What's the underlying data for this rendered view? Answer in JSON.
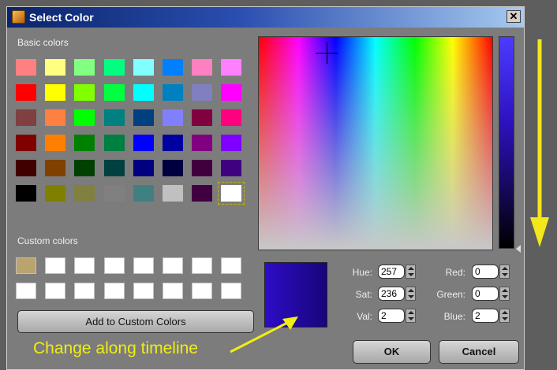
{
  "window": {
    "title": "Select Color",
    "close_label": "✕"
  },
  "basic_colors_label": "Basic colors",
  "custom_colors_label": "Custom colors",
  "basic_colors": [
    "#ff8080",
    "#ffff80",
    "#80ff80",
    "#00ff80",
    "#80ffff",
    "#0080ff",
    "#ff80c0",
    "#ff80ff",
    "#ff0000",
    "#ffff00",
    "#80ff00",
    "#00ff40",
    "#00ffff",
    "#0080c0",
    "#8080c0",
    "#ff00ff",
    "#804040",
    "#ff8040",
    "#00ff00",
    "#008080",
    "#004080",
    "#8080ff",
    "#800040",
    "#ff0080",
    "#800000",
    "#ff8000",
    "#008000",
    "#008040",
    "#0000ff",
    "#0000a0",
    "#800080",
    "#8000ff",
    "#400000",
    "#804000",
    "#004000",
    "#004040",
    "#000080",
    "#000040",
    "#400040",
    "#400080",
    "#000000",
    "#808000",
    "#808040",
    "#808080",
    "#408080",
    "#c0c0c0",
    "#400040",
    "#ffffff"
  ],
  "custom_colors": [
    "#b9a46e",
    "#ffffff",
    "#ffffff",
    "#ffffff",
    "#ffffff",
    "#ffffff",
    "#ffffff",
    "#ffffff",
    "#ffffff",
    "#ffffff",
    "#ffffff",
    "#ffffff",
    "#ffffff",
    "#ffffff",
    "#ffffff",
    "#ffffff"
  ],
  "buttons": {
    "add_custom": "Add to Custom Colors",
    "ok": "OK",
    "cancel": "Cancel"
  },
  "fields": {
    "hue": {
      "label": "Hue:",
      "value": "257"
    },
    "sat": {
      "label": "Sat:",
      "value": "236"
    },
    "val": {
      "label": "Val:",
      "value": "2"
    },
    "red": {
      "label": "Red:",
      "value": "0"
    },
    "green": {
      "label": "Green:",
      "value": "0"
    },
    "blue": {
      "label": "Blue:",
      "value": "2"
    }
  },
  "annotation": "Change along timeline",
  "annotation_color": "#f0ee12"
}
